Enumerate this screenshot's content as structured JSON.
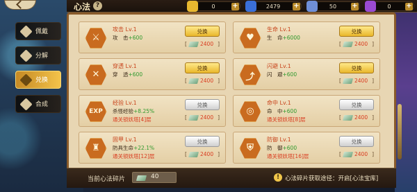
{
  "topbar": {
    "title": "心法",
    "help_glyph": "?",
    "resources": [
      {
        "name": "gold",
        "icon": "gold-ingot-icon",
        "value": "0",
        "plus": "+",
        "color": "#e8b82f"
      },
      {
        "name": "sapphire",
        "icon": "blue-crystal-icon",
        "value": "2479",
        "plus": "+",
        "color": "#3a6fd8"
      },
      {
        "name": "diamond",
        "icon": "diamond-icon",
        "value": "50",
        "plus": "+",
        "color": "#6f8fd8"
      },
      {
        "name": "amethyst",
        "icon": "purple-crystal-icon",
        "value": "0",
        "plus": "+",
        "color": "#9a4ad2"
      }
    ]
  },
  "sidebar": {
    "items": [
      {
        "label": "佩戴",
        "active": false,
        "icon": "equip-icon"
      },
      {
        "label": "分解",
        "active": false,
        "icon": "decompose-icon"
      },
      {
        "label": "兑换",
        "active": true,
        "icon": "exchange-icon"
      },
      {
        "label": "合成",
        "active": false,
        "icon": "compose-icon"
      }
    ]
  },
  "cards": [
    {
      "name": "攻击 Lv.1",
      "stat": "攻　击",
      "bonus": "+600",
      "unlock": "",
      "button": "兑换",
      "button_style": "gold",
      "cost": "2400",
      "icon": "crossed-swords-icon",
      "glyph": "⚔"
    },
    {
      "name": "生命 Lv.1",
      "stat": "生　命",
      "bonus": "+6000",
      "unlock": "",
      "button": "兑换",
      "button_style": "gold",
      "cost": "2400",
      "icon": "heart-icon",
      "glyph": "♥"
    },
    {
      "name": "穿透 Lv.1",
      "stat": "穿　透",
      "bonus": "+600",
      "unlock": "",
      "button": "兑换",
      "button_style": "gold",
      "cost": "2400",
      "icon": "pierce-icon",
      "glyph": "✕"
    },
    {
      "name": "闪避 Lv.1",
      "stat": "闪　避",
      "bonus": "+600",
      "unlock": "",
      "button": "兑换",
      "button_style": "gold",
      "cost": "2400",
      "icon": "boot-icon",
      "glyph": "⤴"
    },
    {
      "name": "经验 Lv.1",
      "stat": "杀怪经验",
      "bonus": "+8.25%",
      "unlock": "通关锁妖塔[4]层",
      "button": "兑换",
      "button_style": "gray",
      "cost": "2400",
      "icon": "exp-icon",
      "glyph": "EXP"
    },
    {
      "name": "命中 Lv.1",
      "stat": "命　中",
      "bonus": "+600",
      "unlock": "通关锁妖塔[8]层",
      "button": "兑换",
      "button_style": "gray",
      "cost": "2400",
      "icon": "target-icon",
      "glyph": "◎"
    },
    {
      "name": "固甲 Lv.1",
      "stat": "防具生命",
      "bonus": "+22.1%",
      "unlock": "通关锁妖塔[12]层",
      "button": "兑换",
      "button_style": "gray",
      "cost": "2400",
      "icon": "armor-icon",
      "glyph": "♜"
    },
    {
      "name": "防御 Lv.1",
      "stat": "防　御",
      "bonus": "+600",
      "unlock": "通关锁妖塔[16]层",
      "button": "兑换",
      "button_style": "gray",
      "cost": "2400",
      "icon": "shield-icon",
      "glyph": "⛨"
    }
  ],
  "bottom": {
    "current_label": "当前心法碎片",
    "current_value": "40",
    "info_glyph": "!",
    "source_text": "心法碎片获取途径：开启[心法宝库]"
  }
}
